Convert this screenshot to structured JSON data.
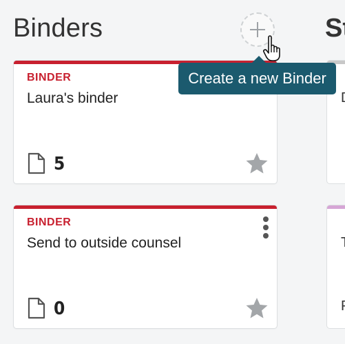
{
  "columns": [
    {
      "title": "Binders"
    },
    {
      "title": "St"
    }
  ],
  "add_button": {
    "tooltip": "Create a new Binder"
  },
  "cards": [
    {
      "type": "BINDER",
      "name": "Laura's binder",
      "doc_count": "5"
    },
    {
      "type": "BINDER",
      "name": "Send to outside counsel",
      "doc_count": "0"
    }
  ],
  "side_cards": [
    {
      "letters": [
        "D"
      ]
    },
    {
      "letters": [
        "T",
        "P"
      ]
    }
  ],
  "colors": {
    "binder_accent": "#c8202f",
    "tooltip_bg": "#1b5a6e",
    "background": "#f4f5f6",
    "icon_gray": "#9ea2a6"
  },
  "icons": {
    "add": "plus-icon",
    "document": "document-icon",
    "favorite": "star-icon",
    "more": "kebab-menu-icon",
    "cursor": "hand-pointer-icon"
  }
}
